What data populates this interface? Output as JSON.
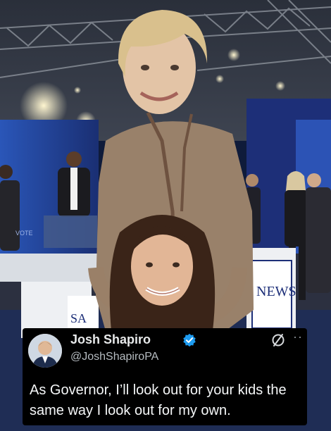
{
  "tweet": {
    "display_name": "Josh Shapiro",
    "handle": "@JoshShapiroPA",
    "text": "As Governor, I’ll look out for your kids the same way I look out for my own.",
    "verified_icon": "verified-badge-icon",
    "avatar_icon": "profile-avatar",
    "action_icon": "no-entry-icon",
    "more_icon": "more-dots-icon"
  },
  "photo": {
    "background_sign_text": "NEWS",
    "podium_text": "SA",
    "screen_text": "VOTE"
  },
  "colors": {
    "stage_blue": "#1e3f8a",
    "card_background": "#000000",
    "verified_blue": "#1d9bf0"
  }
}
